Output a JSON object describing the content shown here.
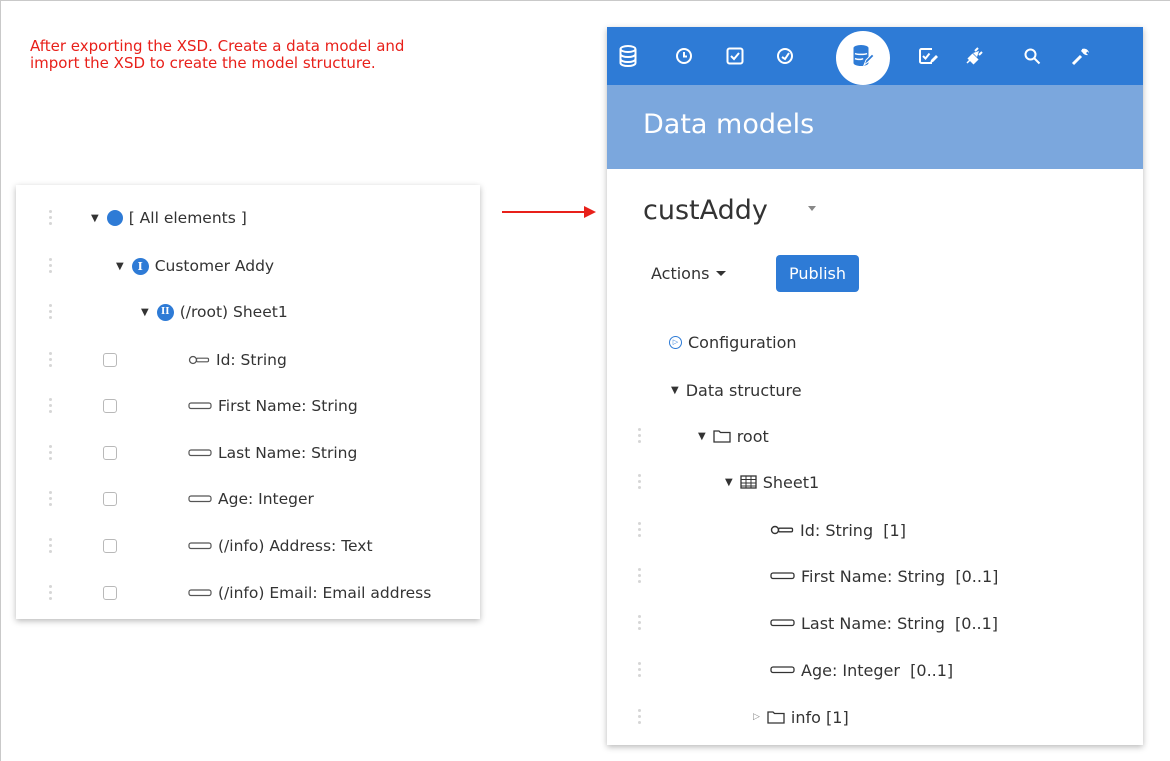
{
  "note": "After exporting the XSD. Create a data model and import the XSD to create the model structure.",
  "left_tree": {
    "rows": [
      {
        "label": "[ All elements ]"
      },
      {
        "label": "Customer Addy",
        "badge": "I"
      },
      {
        "label": "(/root) Sheet1",
        "badge": "II"
      },
      {
        "label": "Id: String"
      },
      {
        "label": "First Name: String"
      },
      {
        "label": "Last Name: String"
      },
      {
        "label": "Age: Integer"
      },
      {
        "label": "(/info) Address: Text"
      },
      {
        "label": "(/info) Email: Email address"
      }
    ]
  },
  "right_panel": {
    "toolbar": [
      "database-icon",
      "clock-icon",
      "checkbox-icon",
      "gauge-icon",
      "data-models-icon",
      "task-edit-icon",
      "plug-icon",
      "search-icon",
      "wrench-icon"
    ],
    "header_title": "Data models",
    "model_name": "custAddy",
    "actions_label": "Actions",
    "publish_label": "Publish",
    "tree": [
      {
        "label": "Configuration"
      },
      {
        "label": "Data structure"
      },
      {
        "label": "root"
      },
      {
        "label": "Sheet1"
      },
      {
        "label": "Id: String  [1]"
      },
      {
        "label": "First Name: String  [0..1]"
      },
      {
        "label": "Last Name: String  [0..1]"
      },
      {
        "label": "Age: Integer  [0..1]"
      },
      {
        "label": "info [1]"
      }
    ]
  },
  "colors": {
    "accent": "#2e7bd6",
    "header_band": "#7ba7dd",
    "annotation": "#e8201a"
  }
}
